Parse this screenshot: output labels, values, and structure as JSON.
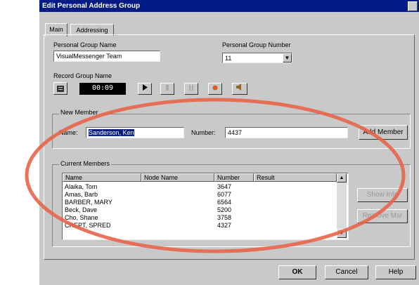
{
  "dialog": {
    "title": "Edit Personal Address Group"
  },
  "tabs": [
    {
      "label": "Main"
    },
    {
      "label": "Addressing"
    }
  ],
  "group_name": {
    "label": "Personal Group Name",
    "value": "VisualMessenger Team"
  },
  "group_number": {
    "label": "Personal Group Number",
    "value": "11"
  },
  "record": {
    "label": "Record Group Name",
    "time": "00:09"
  },
  "new_member": {
    "section_label": "New Member",
    "name_label": "Name:",
    "name_value": "Sanderson, Ken",
    "number_label": "Number:",
    "number_value": "4437",
    "add_label": "Add Member"
  },
  "current_members": {
    "section_label": "Current Members",
    "columns": [
      "Name",
      "Node Name",
      "Number",
      "Result"
    ],
    "rows": [
      {
        "name": "Alaika, Tom",
        "node": "",
        "number": "3647",
        "result": ""
      },
      {
        "name": "Amas, Barb",
        "node": "",
        "number": "6077",
        "result": ""
      },
      {
        "name": "BARBER, MARY",
        "node": "",
        "number": "6564",
        "result": ""
      },
      {
        "name": "Beck, Dave",
        "node": "",
        "number": "5200",
        "result": ""
      },
      {
        "name": "Cho, Shane",
        "node": "",
        "number": "3758",
        "result": ""
      },
      {
        "name": "CREPT, SPRED",
        "node": "",
        "number": "4327",
        "result": ""
      }
    ],
    "side_buttons": [
      "Show Info",
      "Remove Msr"
    ]
  },
  "footer": {
    "ok": "OK",
    "cancel": "Cancel",
    "help": "Help"
  },
  "colors": {
    "title_bar": "#001a86",
    "face": "#c9c9c9",
    "oval": "#e8644a"
  },
  "icons": [
    "address-book-icon",
    "play-icon",
    "stop-icon",
    "pause-icon",
    "record-icon",
    "speaker-icon",
    "dropdown-arrow-icon",
    "scroll-up-icon",
    "scroll-down-icon"
  ]
}
